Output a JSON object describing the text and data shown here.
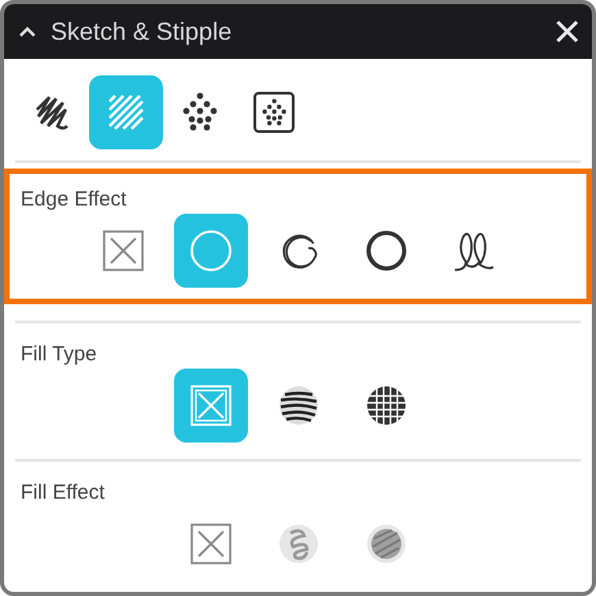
{
  "window": {
    "title": "Sketch & Stipple"
  },
  "tools": [
    {
      "kind": "sketch",
      "selected": false
    },
    {
      "kind": "sketch-fill",
      "selected": true
    },
    {
      "kind": "stipple",
      "selected": false
    },
    {
      "kind": "stipple-fill",
      "selected": false
    }
  ],
  "sections": [
    {
      "label": "Edge Effect",
      "highlighted": true,
      "options": [
        {
          "kind": "none",
          "selected": false
        },
        {
          "kind": "plain",
          "selected": true
        },
        {
          "kind": "sketchy",
          "selected": false
        },
        {
          "kind": "rough",
          "selected": false
        },
        {
          "kind": "loops",
          "selected": false
        }
      ]
    },
    {
      "label": "Fill Type",
      "highlighted": false,
      "options": [
        {
          "kind": "none",
          "selected": true
        },
        {
          "kind": "hatch",
          "selected": false
        },
        {
          "kind": "crosshatch",
          "selected": false
        }
      ]
    },
    {
      "label": "Fill Effect",
      "highlighted": false,
      "options": [
        {
          "kind": "none",
          "selected": false
        },
        {
          "kind": "scribble",
          "selected": false
        },
        {
          "kind": "shade",
          "selected": false
        }
      ]
    }
  ]
}
